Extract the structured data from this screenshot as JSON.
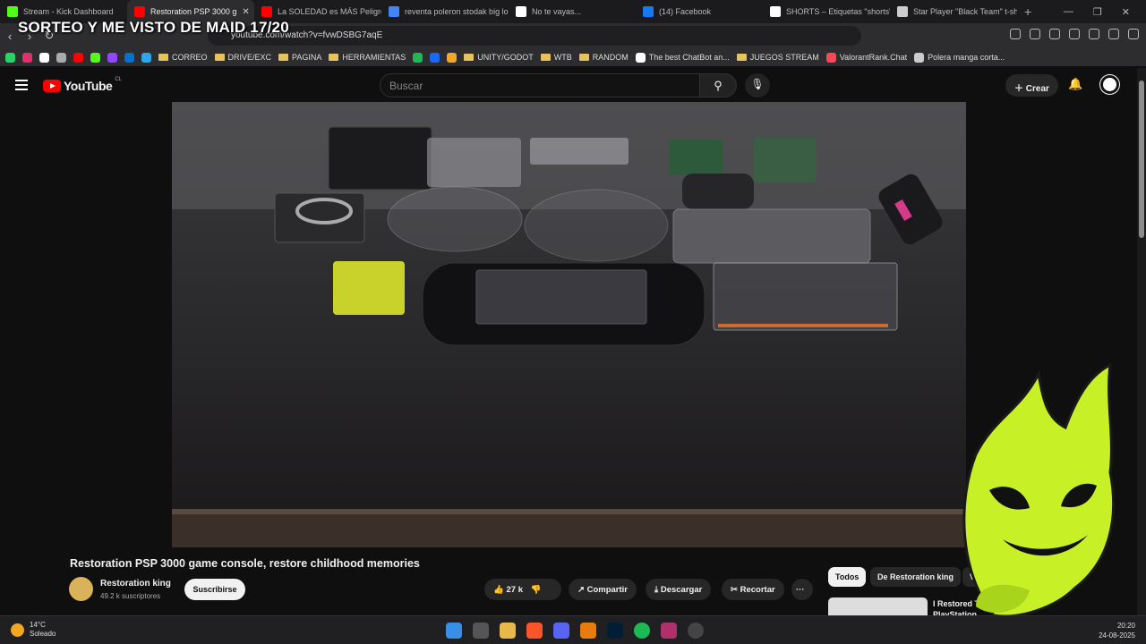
{
  "browser": {
    "tabs": [
      {
        "label": "Stream - Kick Dashboard",
        "icon": "kick-icon",
        "color": "#53fc18"
      },
      {
        "label": "Restoration PSP 3000 g",
        "icon": "youtube-icon",
        "color": "#ff0000",
        "active": true
      },
      {
        "label": "La SOLEDAD es MÁS Peligrosa",
        "icon": "youtube-icon",
        "color": "#ff0000"
      },
      {
        "label": "reventa poleron stodak big log",
        "icon": "google-icon",
        "color": "#4285f4"
      },
      {
        "label": "No te vayas...",
        "icon": "page-icon",
        "color": "#ffffff"
      },
      {
        "label": "(14) Facebook",
        "icon": "facebook-icon",
        "color": "#1877f2"
      },
      {
        "label": "SHORTS – Etiquetas \"shorts\" –",
        "icon": "shorts-icon",
        "color": "#ffffff"
      },
      {
        "label": "Star Player \"Black Team\" t-shirt",
        "icon": "star-icon",
        "color": "#cccccc"
      }
    ],
    "close_tab": "✕",
    "new_tab": "+",
    "url": "youtube.com/watch?v=fvwDSBG7aqE",
    "overlay_text": "SORTEO Y ME VISTO DE MAID 17/20",
    "bookmarks": [
      {
        "label": "",
        "type": "icon",
        "color": "#25d366",
        "icon": "whatsapp-icon"
      },
      {
        "label": "",
        "type": "icon",
        "color": "#e1306c",
        "icon": "instagram-icon"
      },
      {
        "label": "",
        "type": "icon",
        "color": "#ffffff",
        "icon": "x-icon"
      },
      {
        "label": "",
        "type": "icon",
        "color": "#aaaaaa",
        "icon": "apple-icon"
      },
      {
        "label": "",
        "type": "icon",
        "color": "#ff0000",
        "icon": "youtube-icon"
      },
      {
        "label": "",
        "type": "icon",
        "color": "#53fc18",
        "icon": "kick-icon"
      },
      {
        "label": "",
        "type": "icon",
        "color": "#9146ff",
        "icon": "twitch-icon"
      },
      {
        "label": "",
        "type": "icon",
        "color": "#0070d1",
        "icon": "paypal-icon"
      },
      {
        "label": "",
        "type": "icon",
        "color": "#29a9eb",
        "icon": "telegram-icon"
      },
      {
        "label": "CORREO",
        "type": "folder"
      },
      {
        "label": "DRIVE/EXC",
        "type": "folder"
      },
      {
        "label": "PAGINA",
        "type": "folder"
      },
      {
        "label": "HERRAMIENTAS",
        "type": "folder"
      },
      {
        "label": "",
        "type": "icon",
        "color": "#1db954",
        "icon": "fiverr-icon"
      },
      {
        "label": "",
        "type": "icon",
        "color": "#1769ff",
        "icon": "behance-icon"
      },
      {
        "label": "",
        "type": "icon",
        "color": "#f5a623",
        "icon": "grid-icon"
      },
      {
        "label": "UNITY/GODOT",
        "type": "folder"
      },
      {
        "label": "WTB",
        "type": "folder"
      },
      {
        "label": "RANDOM",
        "type": "folder"
      },
      {
        "label": "The best ChatBot an...",
        "type": "link",
        "color": "#ffffff",
        "icon": "chatbot-icon"
      },
      {
        "label": "JUEGOS STREAM",
        "type": "folder"
      },
      {
        "label": "ValorantRank.Chat",
        "type": "link",
        "color": "#ff4655",
        "icon": "valorant-icon"
      },
      {
        "label": "Polera manga corta...",
        "type": "link",
        "color": "#cccccc",
        "icon": "globe-icon"
      }
    ]
  },
  "youtube": {
    "logo_text": "YouTube",
    "country_code": "CL",
    "search_placeholder": "Buscar",
    "create_label": "Crear",
    "video_title": "Restoration PSP 3000 game console, restore childhood memories",
    "channel_name": "Restoration king",
    "subscribers": "49.2 k suscriptores",
    "subscribe_label": "Suscribirse",
    "likes": "27 k",
    "share_label": "Compartir",
    "download_label": "Descargar",
    "clip_label": "Recortar",
    "more_label": "···",
    "chips": [
      "Todos",
      "De Restoration king",
      "Videoconsolas"
    ],
    "rec_title": "I Restored Th... PlayStation..."
  },
  "taskbar": {
    "temp": "14°C",
    "weather": "Soleado",
    "time": "20:20",
    "date": "24-08-2025"
  }
}
